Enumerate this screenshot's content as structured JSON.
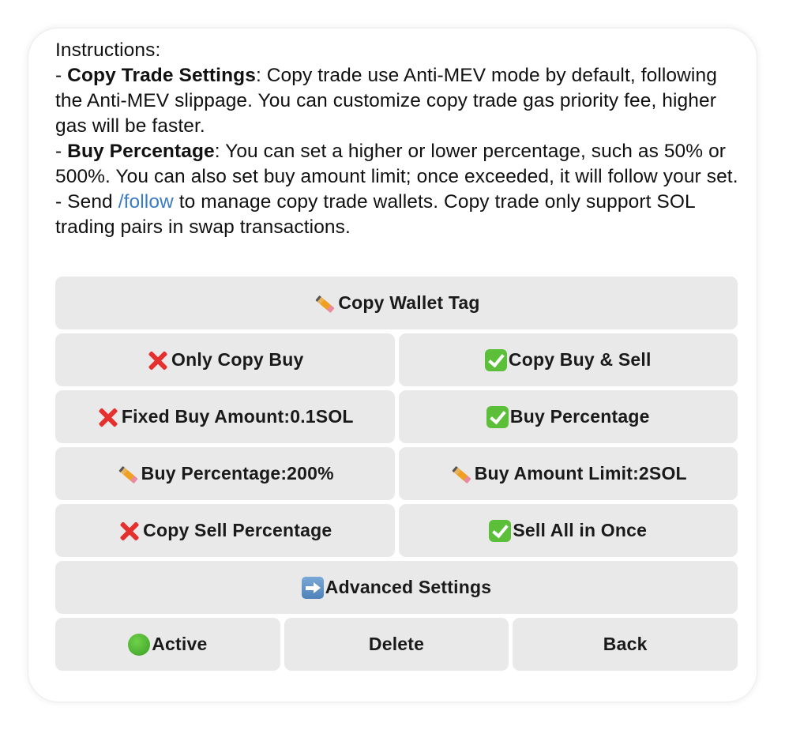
{
  "message": {
    "intro": "Instructions:",
    "item1_prefix": "- ",
    "item1_title": "Copy Trade Settings",
    "item1_text": ": Copy trade use Anti-MEV mode by default, following the Anti-MEV slippage. You can customize copy trade gas priority fee, higher gas will be faster.",
    "item2_prefix": "- ",
    "item2_title": "Buy Percentage",
    "item2_text": ": You can set a higher or lower percentage, such as 50% or 500%. You can also set buy amount limit; once exceeded, it will follow your set.",
    "item3_prefix": "- Send ",
    "item3_link": "/follow",
    "item3_text": " to manage copy trade wallets. Copy trade only support SOL trading pairs in swap transactions."
  },
  "keyboard": {
    "copy_wallet_tag": "Copy Wallet Tag",
    "only_copy_buy": "Only Copy Buy",
    "copy_buy_sell": "Copy Buy & Sell",
    "fixed_buy_amount": "Fixed Buy Amount:0.1SOL",
    "buy_percentage": "Buy Percentage",
    "buy_percentage_value": "Buy Percentage:200%",
    "buy_amount_limit": "Buy Amount Limit:2SOL",
    "copy_sell_percentage": "Copy Sell Percentage",
    "sell_all_in_once": "Sell All in Once",
    "advanced_settings": "Advanced Settings",
    "active": "Active",
    "delete": "Delete",
    "back": "Back"
  },
  "icons": {
    "cross": "red-cross-icon",
    "check": "green-check-icon",
    "pencil": "pencil-icon",
    "arrow": "right-arrow-icon",
    "circle": "green-circle-icon"
  },
  "colors": {
    "link": "#3b7bc4",
    "button_bg": "#e9e9e9",
    "cross": "#e4302f",
    "check": "#5cbf3a"
  }
}
